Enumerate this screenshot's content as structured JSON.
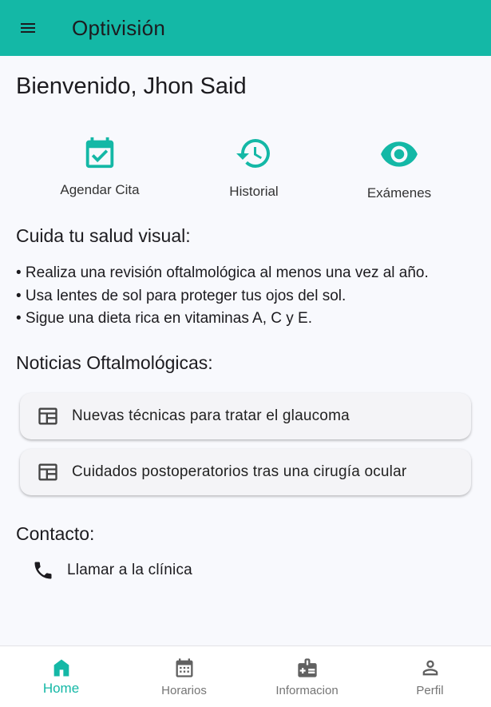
{
  "colors": {
    "primary": "#14b8a6",
    "background": "#f8f9fd",
    "inactive": "#757575"
  },
  "app_bar": {
    "title": "Optivisión",
    "menu_icon": "menu-icon"
  },
  "greeting": "Bienvenido, Jhon Said",
  "quick_actions": [
    {
      "label": "Agendar Cita",
      "icon": "calendar-check-icon"
    },
    {
      "label": "Historial",
      "icon": "history-icon"
    },
    {
      "label": "Exámenes",
      "icon": "eye-icon"
    }
  ],
  "tips": {
    "title": "Cuida tu salud visual:",
    "items": [
      "• Realiza una revisión oftalmológica al menos una vez al año.",
      "• Usa lentes de sol para proteger tus ojos del sol.",
      "• Sigue una dieta rica en vitaminas A, C y E."
    ]
  },
  "news": {
    "title": "Noticias Oftalmológicas:",
    "items": [
      {
        "text": "Nuevas técnicas para tratar el glaucoma",
        "icon": "article-icon"
      },
      {
        "text": "Cuidados postoperatorios tras una cirugía ocular",
        "icon": "article-icon"
      }
    ]
  },
  "contact": {
    "title": "Contacto:",
    "call_label": "Llamar a la clínica",
    "icon": "phone-icon"
  },
  "bottom_nav": {
    "active": "Home",
    "items": [
      {
        "label": "Home",
        "icon": "home-icon"
      },
      {
        "label": "Horarios",
        "icon": "calendar-icon"
      },
      {
        "label": "Informacion",
        "icon": "medical-info-icon"
      },
      {
        "label": "Perfil",
        "icon": "person-icon"
      }
    ]
  }
}
